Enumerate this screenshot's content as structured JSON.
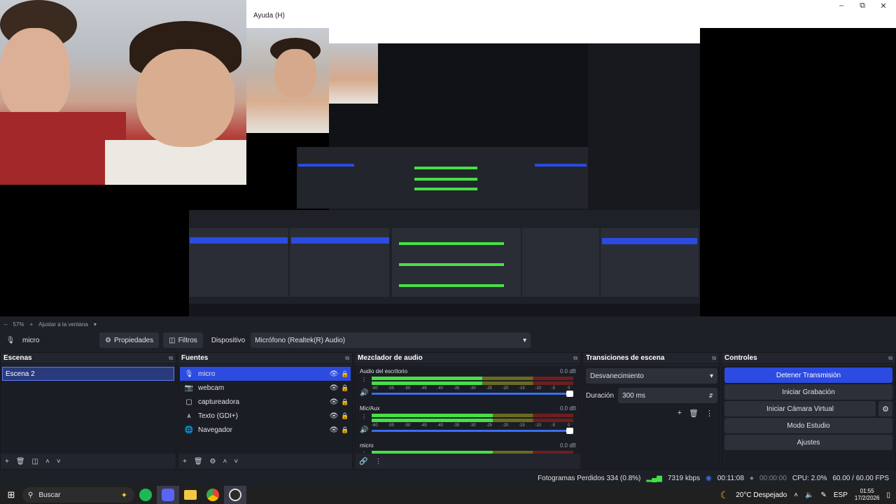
{
  "window": {
    "title": "Ayuda (H)",
    "minimize_icon": "–",
    "maximize_icon": "⧉",
    "close_icon": "✕"
  },
  "preview": {
    "zoom": "57%",
    "fit_label": "Ajustar a la ventana"
  },
  "source_bar": {
    "selected_source": "micro",
    "properties_label": "Propiedades",
    "filters_label": "Filtros",
    "device_label": "Dispositivo",
    "device_value": "Micrófono (Realtek(R) Audio)"
  },
  "scenes": {
    "title": "Escenas",
    "items": [
      "Escena 2"
    ]
  },
  "sources": {
    "title": "Fuentes",
    "items": [
      {
        "name": "micro",
        "icon": "mic-icon",
        "selected": true
      },
      {
        "name": "webcam",
        "icon": "camera-icon",
        "selected": false
      },
      {
        "name": "captureadora",
        "icon": "monitor-icon",
        "selected": false
      },
      {
        "name": "Texto (GDI+)",
        "icon": "text-icon",
        "selected": false
      },
      {
        "name": "Navegador",
        "icon": "globe-icon",
        "selected": false
      }
    ]
  },
  "mixer": {
    "title": "Mezclador de audio",
    "channels": [
      {
        "name": "Audio del escritorio",
        "db": "0.0 dB",
        "level": 0.55
      },
      {
        "name": "Mic/Aux",
        "db": "0.0 dB",
        "level": 0.6
      },
      {
        "name": "micro",
        "db": "0.0 dB",
        "level": 0.6
      }
    ],
    "scale": [
      "-60",
      "-55",
      "-50",
      "-45",
      "-40",
      "-35",
      "-30",
      "-25",
      "-20",
      "-15",
      "-10",
      "-5",
      "0"
    ]
  },
  "transitions": {
    "title": "Transiciones de escena",
    "selected": "Desvanecimiento",
    "duration_label": "Duración",
    "duration_value": "300 ms"
  },
  "controls": {
    "title": "Controles",
    "buttons": [
      "Detener Transmisión",
      "Iniciar Grabación",
      "Iniciar Cámara Virtual",
      "Modo Estudio",
      "Ajustes"
    ]
  },
  "status": {
    "dropped_frames": "Fotogramas Perdidos 334 (0.8%)",
    "bitrate": "7319 kbps",
    "stream_time": "00:11:08",
    "rec_time": "00:00:00",
    "cpu": "CPU: 2.0%",
    "fps": "60.00 / 60.00 FPS"
  },
  "taskbar": {
    "search_placeholder": "Buscar",
    "weather": "20°C  Despejado",
    "language": "ESP",
    "time": "01:55",
    "date": "17/2/2026"
  },
  "colors": {
    "accent": "#2c4be0",
    "panel": "#22252d",
    "meter_green": "#46e046"
  }
}
